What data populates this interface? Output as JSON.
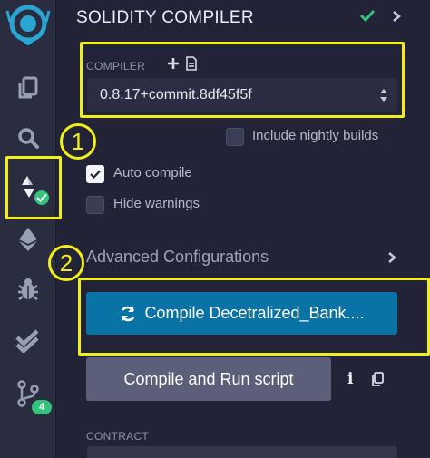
{
  "header": {
    "title": "SOLIDITY COMPILER"
  },
  "compiler": {
    "label": "COMPILER",
    "version": "0.8.17+commit.8df45f5f"
  },
  "annotations": {
    "step1": "1",
    "step2": "2"
  },
  "options": {
    "include_nightly": {
      "label": "Include nightly builds",
      "checked": false
    },
    "auto_compile": {
      "label": "Auto compile",
      "checked": true
    },
    "hide_warnings": {
      "label": "Hide warnings",
      "checked": false
    }
  },
  "advanced": {
    "label": "Advanced Configurations"
  },
  "buttons": {
    "compile": "Compile Decetralized_Bank....",
    "run_script": "Compile and Run script"
  },
  "contract": {
    "label": "CONTRACT"
  },
  "rail": {
    "icons": [
      "remix-logo-icon",
      "file-explorer-icon",
      "search-icon",
      "solidity-compiler-icon",
      "deploy-run-icon",
      "debugger-icon",
      "testing-icon",
      "git-icon"
    ],
    "git_badge": "4"
  },
  "colors": {
    "accent_yellow": "#f2ef18",
    "compile_blue": "#0a73a6",
    "success_green": "#33c37a",
    "background": "#222336"
  }
}
